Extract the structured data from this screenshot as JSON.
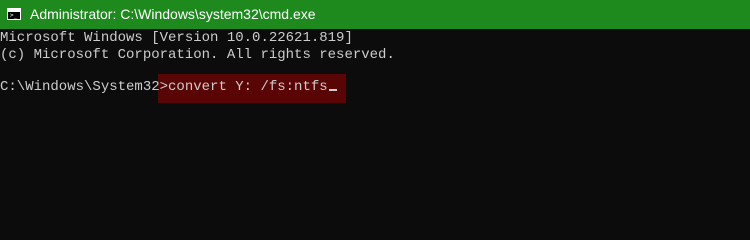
{
  "window": {
    "title": "Administrator: C:\\Windows\\system32\\cmd.exe",
    "titlebar_color": "#1e8a1e",
    "background": "#0c0c0c",
    "app_icon": "cmd-console-icon"
  },
  "console": {
    "line1": "Microsoft Windows [Version 10.0.22621.819]",
    "line2": "(c) Microsoft Corporation. All rights reserved.",
    "prompt": "C:\\Windows\\System32>",
    "command": "convert Y: /fs:ntfs",
    "highlight_color": "#5a0505"
  }
}
